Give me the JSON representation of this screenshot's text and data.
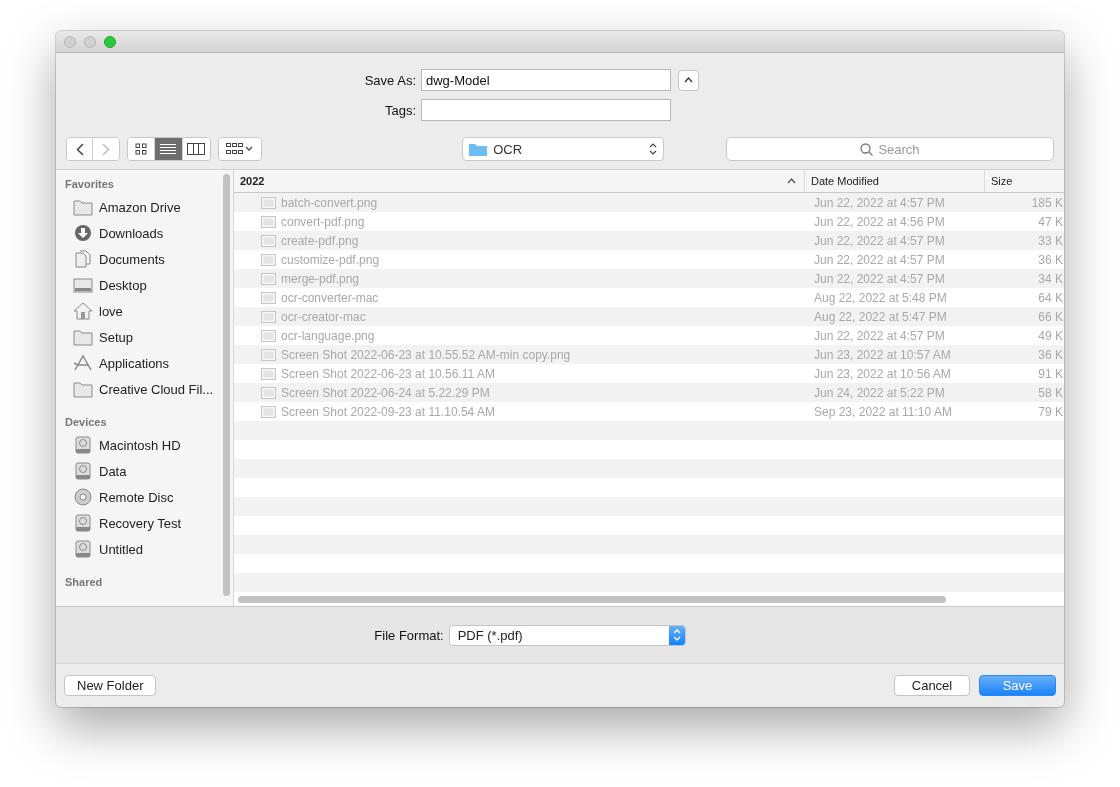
{
  "window": {
    "title_buttons": [
      {
        "kind": "close",
        "disabled": true
      },
      {
        "kind": "minimize",
        "disabled": true
      },
      {
        "kind": "zoom",
        "disabled": false
      }
    ]
  },
  "save_as": {
    "label": "Save As:",
    "value": "dwg-Model",
    "expanded": false
  },
  "tags": {
    "label": "Tags:"
  },
  "toolbar": {
    "back": {
      "disabled": false
    },
    "forward": {
      "disabled": true
    },
    "view_modes": [
      {
        "kind": "icons",
        "selected": false
      },
      {
        "kind": "list",
        "selected": true
      },
      {
        "kind": "columns",
        "selected": false
      }
    ],
    "location": "OCR",
    "search": {
      "placeholder": "Search"
    }
  },
  "sidebar": {
    "sections": [
      {
        "title": "Favorites",
        "items": [
          {
            "label": "Amazon Drive",
            "kind": "folder"
          },
          {
            "label": "Downloads",
            "kind": "download"
          },
          {
            "label": "Documents",
            "kind": "documents"
          },
          {
            "label": "Desktop",
            "kind": "desktop"
          },
          {
            "label": "love",
            "kind": "home"
          },
          {
            "label": "Setup",
            "kind": "folder"
          },
          {
            "label": "Applications",
            "kind": "applications"
          },
          {
            "label": "Creative Cloud Fil...",
            "kind": "folder"
          }
        ]
      },
      {
        "title": "Devices",
        "items": [
          {
            "label": "Macintosh HD",
            "kind": "drive"
          },
          {
            "label": "Data",
            "kind": "drive"
          },
          {
            "label": "Remote Disc",
            "kind": "disc"
          },
          {
            "label": "Recovery Test",
            "kind": "drive"
          },
          {
            "label": "Untitled",
            "kind": "drive"
          }
        ]
      },
      {
        "title": "Shared"
      }
    ]
  },
  "table": {
    "columns": [
      {
        "label": "2022",
        "sorted": true
      },
      {
        "label": "Date Modified",
        "sorted": false
      },
      {
        "label": "Size",
        "sorted": false
      }
    ],
    "rows": [
      {
        "name": "batch-convert.png",
        "date": "Jun 22, 2022 at 4:57 PM",
        "size": "185 K"
      },
      {
        "name": "convert-pdf.png",
        "date": "Jun 22, 2022 at 4:56 PM",
        "size": "47 K"
      },
      {
        "name": "create-pdf.png",
        "date": "Jun 22, 2022 at 4:57 PM",
        "size": "33 K"
      },
      {
        "name": "customize-pdf.png",
        "date": "Jun 22, 2022 at 4:57 PM",
        "size": "36 K"
      },
      {
        "name": "merge-pdf.png",
        "date": "Jun 22, 2022 at 4:57 PM",
        "size": "34 K"
      },
      {
        "name": "ocr-converter-mac",
        "date": "Aug 22, 2022 at 5:48 PM",
        "size": "64 K"
      },
      {
        "name": "ocr-creator-mac",
        "date": "Aug 22, 2022 at 5:47 PM",
        "size": "66 K"
      },
      {
        "name": "ocr-language.png",
        "date": "Jun 22, 2022 at 4:57 PM",
        "size": "49 K"
      },
      {
        "name": "Screen Shot 2022-06-23 at 10.55.52 AM-min copy.png",
        "date": "Jun 23, 2022 at 10:57 AM",
        "size": "36 K"
      },
      {
        "name": "Screen Shot 2022-06-23 at 10.56.11 AM",
        "date": "Jun 23, 2022 at 10:56 AM",
        "size": "91 K"
      },
      {
        "name": "Screen Shot 2022-06-24 at 5.22.29 PM",
        "date": "Jun 24, 2022 at 5:22 PM",
        "size": "58 K"
      },
      {
        "name": "Screen Shot 2022-09-23 at 11.10.54 AM",
        "date": "Sep 23, 2022 at 11:10 AM",
        "size": "79 K"
      }
    ]
  },
  "file_format": {
    "label": "File Format:",
    "value": "PDF (*.pdf)"
  },
  "buttons": [
    {
      "label": "New Folder",
      "kind": "plain"
    },
    {
      "label": "Cancel",
      "kind": "plain"
    },
    {
      "label": "Save",
      "kind": "default"
    }
  ]
}
